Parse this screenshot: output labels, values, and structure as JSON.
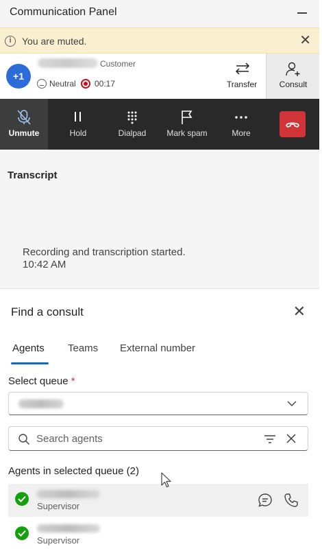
{
  "header": {
    "title": "Communication Panel"
  },
  "banner": {
    "text": "You are muted."
  },
  "customer": {
    "avatar_text": "+1",
    "label": "Customer",
    "sentiment": "Neutral",
    "timer": "00:17"
  },
  "actions": {
    "transfer": "Transfer",
    "consult": "Consult"
  },
  "toolbar": {
    "unmute": "Unmute",
    "hold": "Hold",
    "dialpad": "Dialpad",
    "mark_spam": "Mark spam",
    "more": "More"
  },
  "transcript": {
    "heading": "Transcript",
    "message": "Recording and transcription started.",
    "time": "10:42 AM"
  },
  "consult_panel": {
    "title": "Find a consult",
    "tabs": [
      "Agents",
      "Teams",
      "External number"
    ],
    "select_queue_label": "Select queue",
    "required_mark": "*",
    "search_placeholder": "Search agents",
    "agents_heading": "Agents in selected queue (2)",
    "agents": [
      {
        "role": "Supervisor",
        "status": "available"
      },
      {
        "role": "Supervisor",
        "status": "available"
      }
    ]
  },
  "colors": {
    "accent": "#0f6cbd",
    "avatar": "#2b6cd9",
    "end_call": "#d13438",
    "available": "#13a10e",
    "banner": "#faf0cf",
    "toolbar": "#292929"
  },
  "icons": [
    "info-icon",
    "close-icon",
    "minimize-icon",
    "sentiment-neutral-icon",
    "recording-icon",
    "transfer-icon",
    "consult-icon",
    "mic-off-icon",
    "pause-icon",
    "dialpad-icon",
    "flag-icon",
    "more-icon",
    "end-call-icon",
    "chevron-down-icon",
    "search-icon",
    "filter-icon",
    "chat-icon",
    "phone-icon"
  ]
}
